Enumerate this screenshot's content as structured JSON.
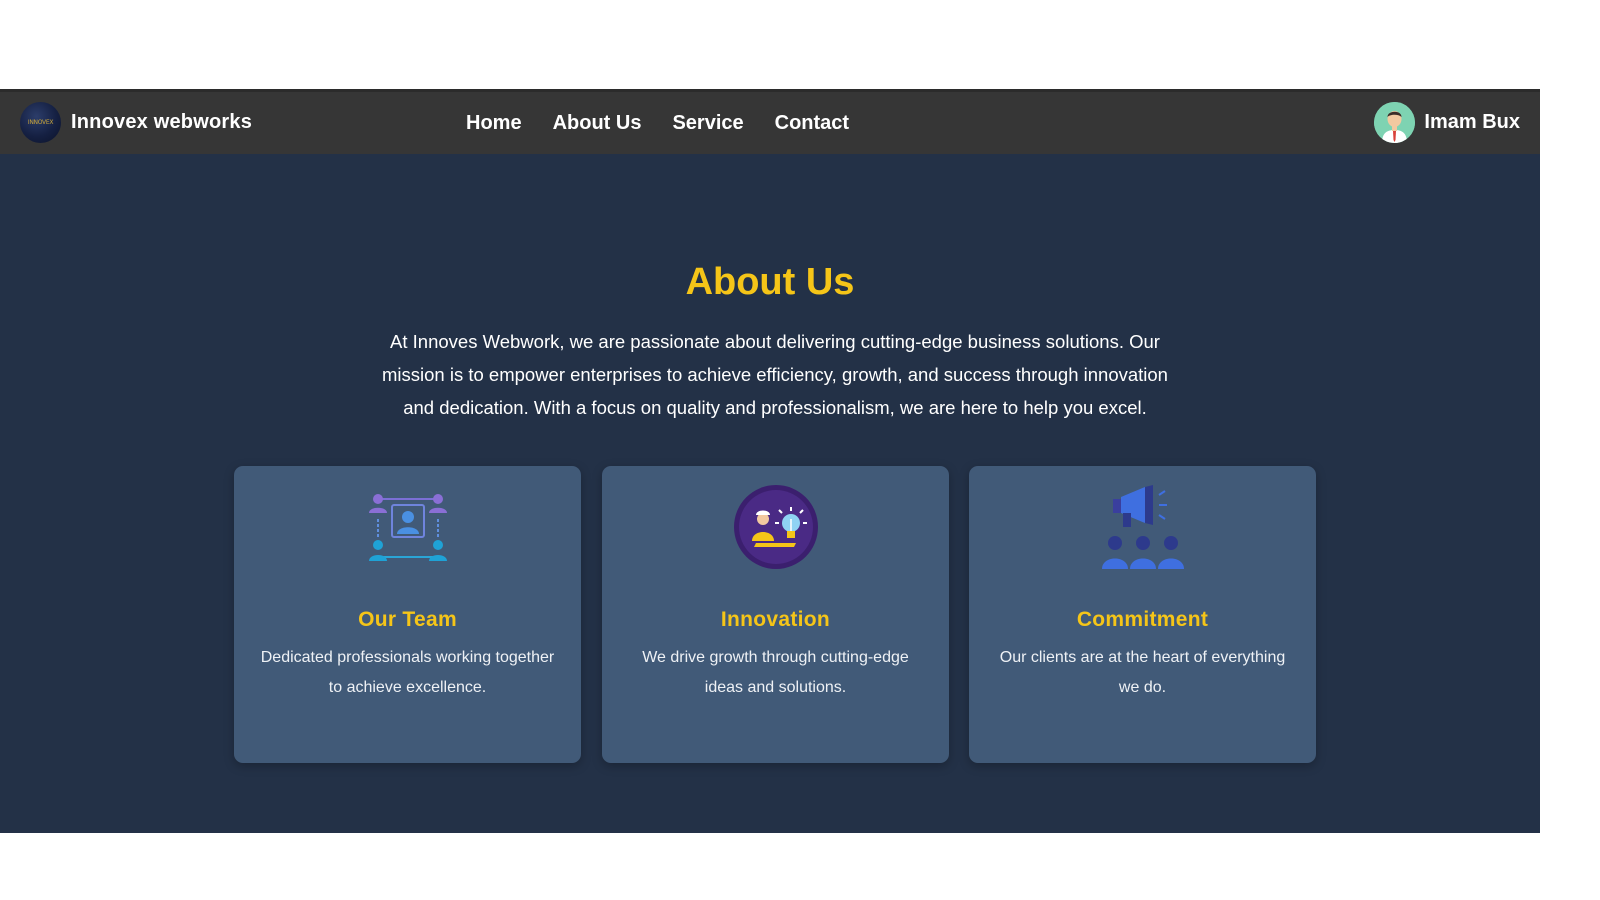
{
  "navbar": {
    "brand_name": "Innovex webworks",
    "logo_text": "INNOVEX",
    "links": [
      "Home",
      "About Us",
      "Service",
      "Contact"
    ],
    "user_name": "Imam Bux"
  },
  "about": {
    "title": "About Us",
    "description": "At Innoves Webwork, we are passionate about delivering cutting-edge business solutions. Our mission is to empower enterprises to achieve efficiency, growth, and success through innovation and dedication. With a focus on quality and professionalism, we are here to help you excel."
  },
  "cards": [
    {
      "icon": "team-network-icon",
      "title": "Our Team",
      "description": "Dedicated professionals working together to achieve excellence."
    },
    {
      "icon": "innovation-lightbulb-icon",
      "title": "Innovation",
      "description": "We drive growth through cutting-edge ideas and solutions."
    },
    {
      "icon": "megaphone-audience-icon",
      "title": "Commitment",
      "description": "Our clients are at the heart of everything we do."
    }
  ],
  "colors": {
    "navbar_bg": "#363636",
    "page_bg": "#233147",
    "card_bg": "#415a78",
    "accent": "#f5c518",
    "text": "#ffffff"
  }
}
